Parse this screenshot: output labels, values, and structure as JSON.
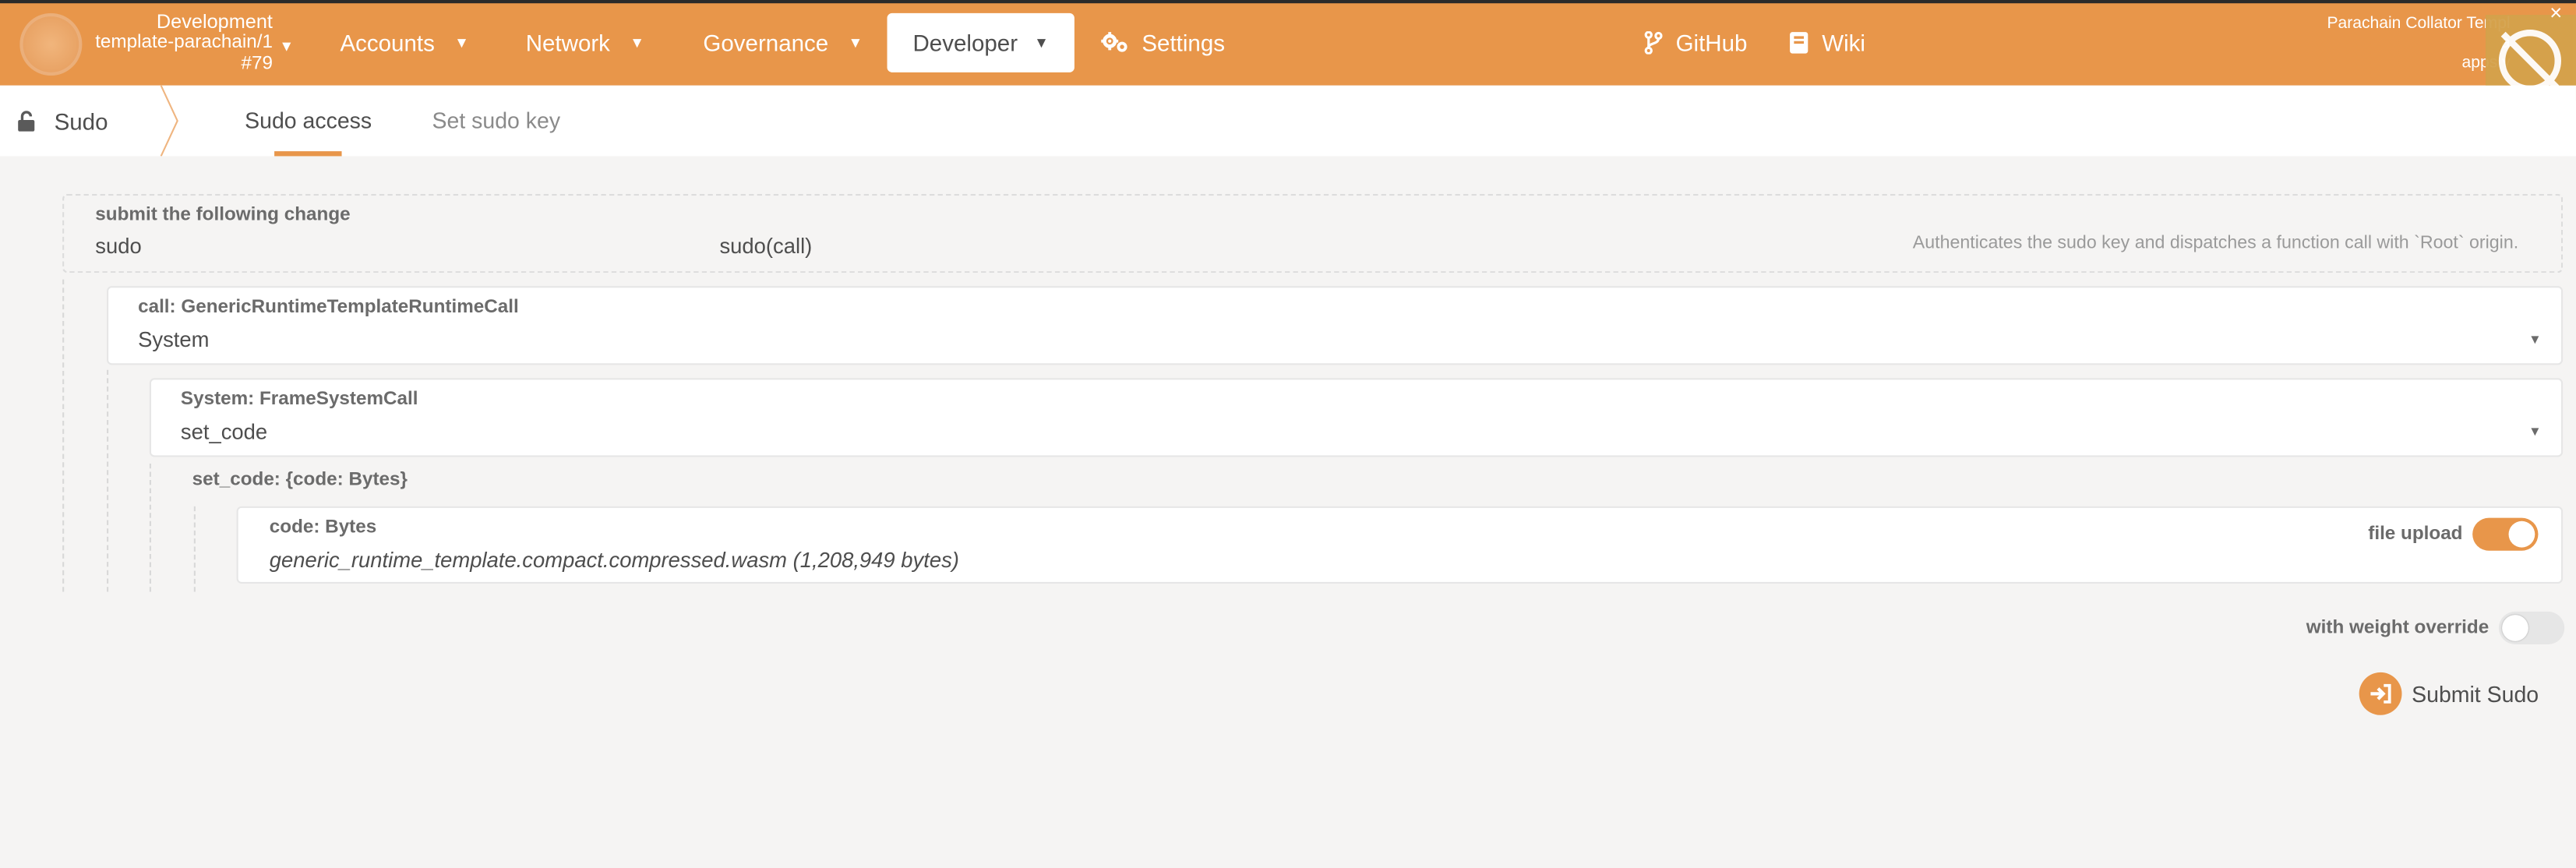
{
  "chain": {
    "name": "Development",
    "runtime": "template-parachain/1",
    "block": "#79"
  },
  "nav": {
    "accounts": "Accounts",
    "network": "Network",
    "governance": "Governance",
    "developer": "Developer",
    "settings": "Settings",
    "github": "GitHub",
    "wiki": "Wiki"
  },
  "right_info": {
    "line1": "Parachain Collator Templ",
    "line2": "a",
    "line3": "apps v"
  },
  "notify_close": "×",
  "subnav": {
    "root": "Sudo",
    "tabs": [
      {
        "label": "Sudo access",
        "active": true
      },
      {
        "label": "Set sudo key",
        "active": false
      }
    ]
  },
  "submit_change": {
    "label": "submit the following change",
    "section": "sudo",
    "method": "sudo(call)",
    "description": "Authenticates the sudo key and dispatches a function call with `Root` origin."
  },
  "call": {
    "label": "call: GenericRuntimeTemplateRuntimeCall",
    "value": "System"
  },
  "system_call": {
    "label": "System: FrameSystemCall",
    "value": "set_code"
  },
  "set_code": {
    "label": "set_code: {code: Bytes}"
  },
  "code": {
    "label": "code: Bytes",
    "value": "generic_runtime_template.compact.compressed.wasm (1,208,949 bytes)",
    "file_upload_label": "file upload",
    "file_upload_on": true
  },
  "weight_override": {
    "label": "with weight override",
    "on": false
  },
  "submit": {
    "label": "Submit Sudo"
  },
  "colors": {
    "accent": "#e8964a",
    "background": "#f5f4f3"
  }
}
